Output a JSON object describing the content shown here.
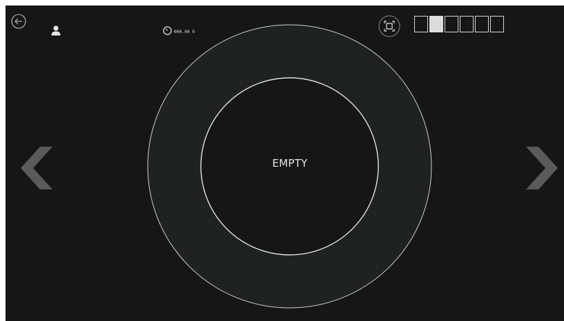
{
  "header": {
    "back_icon": "arrow-left-circle-icon",
    "user_icon": "user-icon",
    "timer_icon": "clock-icon",
    "timer_value": "000.00 h",
    "fullscreen_icon": "fullscreen-icon"
  },
  "slots": {
    "total": 6,
    "filled_index": 1
  },
  "navigation": {
    "prev_icon": "chevron-left-icon",
    "next_icon": "chevron-right-icon"
  },
  "dial": {
    "center_label": "EMPTY"
  },
  "colors": {
    "background": "#161616",
    "ring": "#1e2322",
    "foreground": "#e6e6e6",
    "arrow": "#5a5a5a"
  }
}
